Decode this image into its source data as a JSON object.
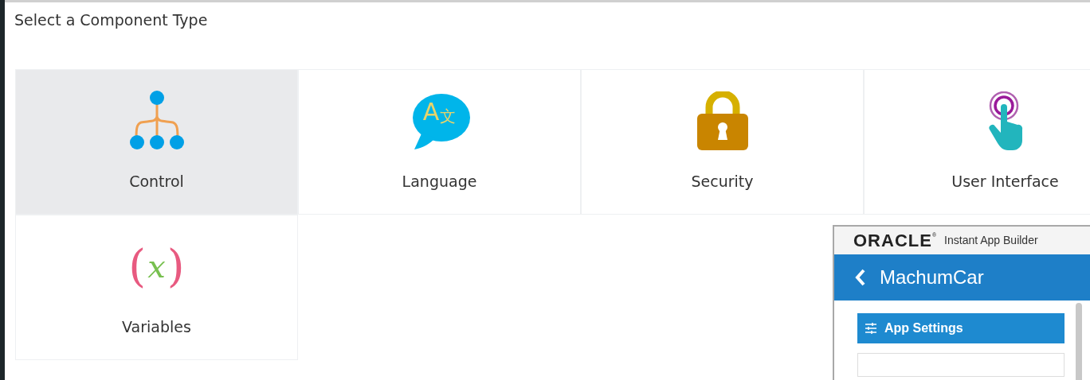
{
  "title": "Select a Component Type",
  "tiles": [
    {
      "label": "Control",
      "kind": "control",
      "selected": true
    },
    {
      "label": "Language",
      "kind": "language",
      "selected": false,
      "glyphs": [
        "A",
        "文"
      ]
    },
    {
      "label": "Security",
      "kind": "security",
      "selected": false
    },
    {
      "label": "User Interface",
      "kind": "ui",
      "selected": false
    },
    {
      "label": "Variables",
      "kind": "variables",
      "selected": false,
      "glyphs": [
        "(",
        "x",
        ")"
      ]
    }
  ],
  "overlay": {
    "logo": "ORACLE",
    "logo_mark": "®",
    "product": "Instant App Builder",
    "app_name": "MachumCar",
    "button": "App Settings"
  }
}
